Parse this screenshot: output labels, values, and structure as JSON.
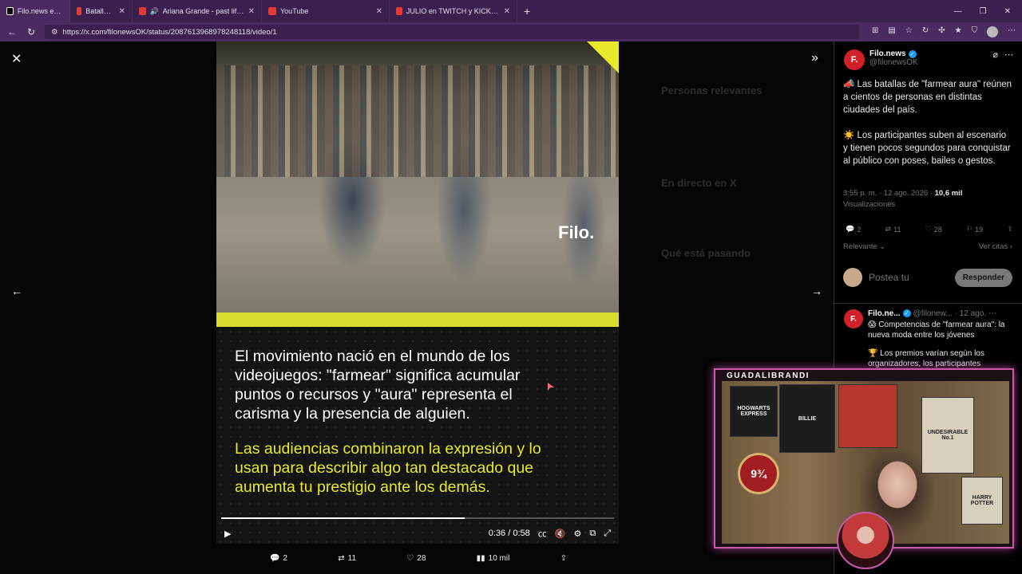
{
  "browser": {
    "tabs": [
      {
        "title": "Filo.news en X: \"",
        "favicon_color": "#ffffff",
        "active": true
      },
      {
        "title": "Batallas de \"fa",
        "favicon_color": "#e53935",
        "active": false
      },
      {
        "title": "Ariana Grande - past life (lyric",
        "favicon_color": "#e53935",
        "active": false
      },
      {
        "title": "YouTube",
        "favicon_color": "#e53935",
        "active": false
      },
      {
        "title": "JULIO en TWITCH y KICK ARGENTI",
        "favicon_color": "#e53935",
        "active": false
      }
    ],
    "url": "https://x.com/filonewsOK/status/2087613968978248118/video/1"
  },
  "video": {
    "para1": "El movimiento nació en el mundo de los videojuegos: \"farmear\" significa acumular puntos o recursos y \"aura\" representa el carisma y la presencia de alguien.",
    "para2": "Las audiencias combinaron la expresión y lo usan para describir algo tan destacado que aumenta tu prestigio ante los demás.",
    "logo": "Filo.",
    "time": "0:36 / 0:58",
    "progress": 0.62
  },
  "actions": {
    "replies": "2",
    "reposts": "11",
    "likes": "28",
    "views": "10 mil"
  },
  "background": {
    "relevant": "Personas relevantes",
    "live": "En directo en X",
    "happening": "Qué está pasando"
  },
  "tweet": {
    "avatar": "F.",
    "name": "Filo.news",
    "handle": "@filonewsOK",
    "p1": "📣 Las batallas de \"farmear aura\" reúnen a cientos de personas en distintas ciudades del país.",
    "p2": "☀️ Los participantes suben al escenario y tienen pocos segundos para conquistar al público con poses, bailes o gestos.",
    "time": "3:55 p. m. · 12 ago. 2026 ·",
    "views_count": "10,6 mil",
    "views_label": "Visualizaciones",
    "stats": {
      "replies": "2",
      "reposts": "11",
      "likes": "28",
      "bookmarks": "19"
    },
    "sort": "Relevante",
    "quotes": "Ver citas",
    "reply_placeholder": "Postea tu",
    "reply_button": "Responder"
  },
  "reply": {
    "avatar": "F.",
    "name": "Filo.ne...",
    "handle": "@filonew...",
    "date": "· 12 ago.",
    "p1": "😱 Competencias de \"farmear aura\": la nueva moda entre los jóvenes",
    "p2": "🏆 Los premios varían según los organizadores, los participantes"
  },
  "cam": {
    "name": "GUADALIBRANDI",
    "posters": [
      "HOGWARTS EXPRESS",
      "BILLIE",
      "UNDESIRABLE No.1",
      "HARRY POTTER"
    ],
    "platform": "9¾"
  }
}
